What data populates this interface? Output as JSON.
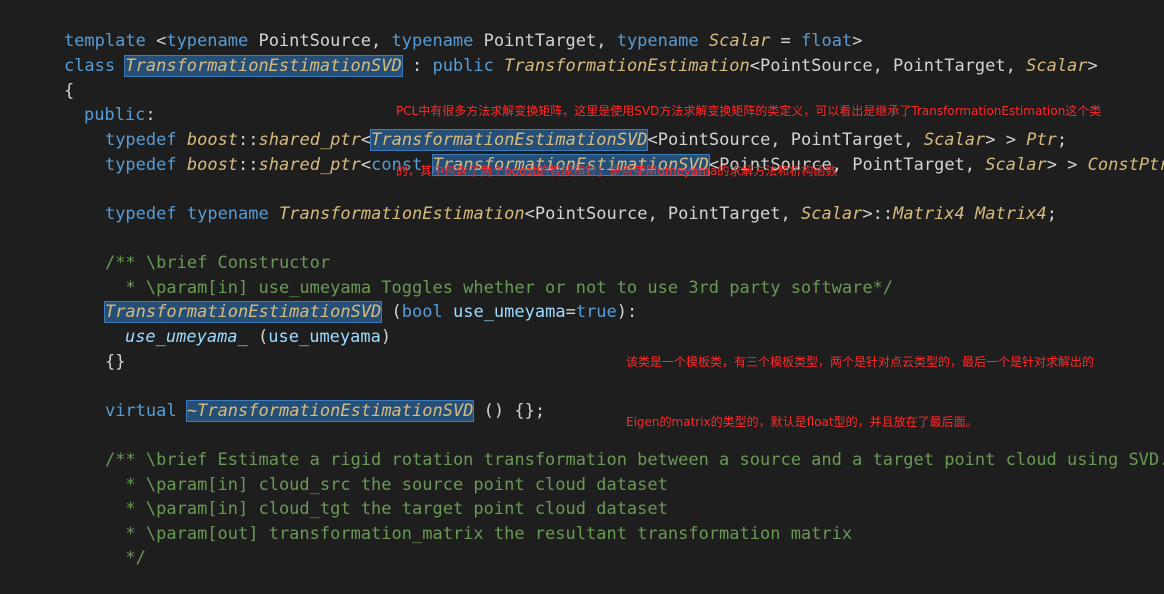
{
  "code": {
    "l1": {
      "kw1": "template",
      "p1": " <",
      "kw2": "typename",
      "p2": " PointSource, ",
      "kw3": "typename",
      "p3": " PointTarget, ",
      "kw4": "typename",
      "p4": " ",
      "ty1": "Scalar",
      "p5": " = ",
      "kw5": "float",
      "p6": ">"
    },
    "l2": {
      "kw1": "class",
      "p1": " ",
      "hl1": "TransformationEstimationSVD",
      "p2": " : ",
      "kw2": "public",
      "p3": " ",
      "ty1": "TransformationEstimation",
      "p4": "<PointSource, PointTarget, ",
      "ty2": "Scalar",
      "p5": ">"
    },
    "l3": {
      "p1": "{"
    },
    "l4": {
      "kw1": "public",
      "p1": ":"
    },
    "l5": {
      "kw1": "typedef",
      "p1": " ",
      "ty1": "boost",
      "p2": "::",
      "ty2": "shared_ptr",
      "p3": "<",
      "hl1": "TransformationEstimationSVD",
      "p4": "<PointSource, PointTarget, ",
      "ty3": "Scalar",
      "p5": "> > ",
      "ty4": "Ptr",
      "p6": ";"
    },
    "l6": {
      "kw1": "typedef",
      "p1": " ",
      "ty1": "boost",
      "p2": "::",
      "ty2": "shared_ptr",
      "p3": "<",
      "kw2": "const",
      "p4": " ",
      "hl1": "TransformationEstimationSVD",
      "p5": "<PointSource, PointTarget, ",
      "ty3": "Scalar",
      "p6": "> > ",
      "ty4": "ConstPtr",
      "p7": ";"
    },
    "l8": {
      "kw1": "typedef",
      "p1": " ",
      "kw2": "typename",
      "p2": " ",
      "ty1": "TransformationEstimation",
      "p3": "<PointSource, PointTarget, ",
      "ty2": "Scalar",
      "p4": ">::",
      "ty3": "Matrix4",
      "p5": " ",
      "ty4": "Matrix4",
      "p6": ";"
    },
    "l10": {
      "cm": "/** \\brief Constructor"
    },
    "l11": {
      "cm": "  * \\param[in] use_umeyama Toggles whether or not to use 3rd party software*/"
    },
    "l12": {
      "hl1": "TransformationEstimationSVD",
      "p1": " (",
      "kw1": "bool",
      "p2": " ",
      "pm1": "use_umeyama",
      "p3": "=",
      "kw2": "true",
      "p4": "):"
    },
    "l13": {
      "pm1": "use_umeyama_",
      "p1": " (",
      "pm2": "use_umeyama",
      "p2": ")"
    },
    "l14": {
      "p1": "{}"
    },
    "l16": {
      "kw1": "virtual",
      "p1": " ",
      "hl1": "~TransformationEstimationSVD",
      "p2": " () {};"
    },
    "l18": {
      "cm": "/** \\brief Estimate a rigid rotation transformation between a source and a target point cloud using SVD."
    },
    "l19": {
      "cm": "  * \\param[in] cloud_src the source point cloud dataset"
    },
    "l20": {
      "cm": "  * \\param[in] cloud_tgt the target point cloud dataset"
    },
    "l21": {
      "cm": "  * \\param[out] transformation_matrix the resultant transformation matrix"
    },
    "l22": {
      "cm": "  */"
    }
  },
  "annotations": {
    "a1_line1": "PCL中有很多方法求解变换矩阵，这里是使用SVD方法求解变换矩阵的类定义，可以看出是继承了TransformationEstimation这个类",
    "a1_line2": "的，其中包含了两个boost的智能指针；是否使用umeyama的求解方法和析构函数",
    "a2_line1": "该类是一个模板类，有三个模板类型，两个是针对点云类型的，最后一个是针对求解出的",
    "a2_line2": "Eigen的matrix的类型的，默认是float型的，并且放在了最后面。"
  },
  "colors": {
    "background": "#1e1e1e",
    "keyword": "#569cd6",
    "type": "#d7ba7d",
    "comment": "#6a9955",
    "annotation": "#ff2a2a",
    "highlight": "#264f78"
  }
}
